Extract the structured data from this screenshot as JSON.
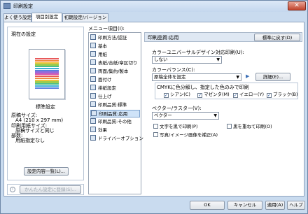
{
  "window": {
    "title": "印刷設定",
    "close_glyph": "✕"
  },
  "tabs": [
    {
      "label": "よく使う設定"
    },
    {
      "label": "項目別設定"
    },
    {
      "label": "初期設定/バージョン"
    }
  ],
  "left": {
    "current_settings_label": "現在の設定",
    "setting_name": "標準設定",
    "details": [
      "原稿サイズ:",
      "A4 (210 x 297 mm)",
      "印刷用紙サイズ:",
      "原稿サイズと同じ",
      "部数:",
      "用紙指定なし"
    ],
    "details_button": "設定内容一覧(L)...",
    "register_button": "かんたん設定に登録(S)..."
  },
  "menu": {
    "label": "メニュー項目(I):",
    "items": [
      {
        "label": "印刷方法/認証",
        "icon": "print-method-icon"
      },
      {
        "label": "基本",
        "icon": "basic-icon"
      },
      {
        "label": "用紙",
        "icon": "paper-icon"
      },
      {
        "label": "表紙/合紙/章区切り",
        "icon": "cover-icon"
      },
      {
        "label": "両面/集約/製本",
        "icon": "duplex-icon"
      },
      {
        "label": "面付け",
        "icon": "imposition-icon"
      },
      {
        "label": "排紙設定",
        "icon": "output-icon"
      },
      {
        "label": "仕上げ",
        "icon": "finish-icon"
      },
      {
        "label": "印刷品質:標準",
        "icon": "quality-standard-icon"
      },
      {
        "label": "印刷品質:応用",
        "icon": "quality-advanced-icon"
      },
      {
        "label": "印刷品質:その他",
        "icon": "quality-other-icon"
      },
      {
        "label": "効果",
        "icon": "effect-icon"
      },
      {
        "label": "ドライバーオプション",
        "icon": "driver-option-icon"
      }
    ]
  },
  "right": {
    "header": "印刷品質:応用",
    "reset_button": "標準に戻す(D)",
    "universal_design_label": "カラーユニバーサルデザイン対応印刷(U):",
    "universal_design_value": "しない",
    "color_balance_label": "カラーバランス(C):",
    "color_balance_value": "原稿全体を設定",
    "details_button": "詳細(E)...",
    "cmyk_label": "CMYKに色分解し、指定した色のみで印刷",
    "cmyk_options": [
      {
        "label": "シアン(C)",
        "checked": true
      },
      {
        "label": "マゼンタ(M)",
        "checked": true
      },
      {
        "label": "イエロー(Y)",
        "checked": true
      },
      {
        "label": "ブラック(B)",
        "checked": true
      }
    ],
    "vector_label": "ベクター/ラスター(V):",
    "vector_value": "ベクター",
    "black_text_label": "文字を黒で印刷(P)",
    "black_overprint_label": "黒を重ねて印刷(O)",
    "photo_correction_label": "写真/イメージ画像を補正(A)"
  },
  "bottom": {
    "ok": "OK",
    "cancel": "キャンセル",
    "apply": "適用(A)",
    "help": "ヘルプ"
  },
  "colors": {
    "selected_bg": "#cfe3f8",
    "window_bg": "#c9dbef",
    "close_red": "#c0442d"
  }
}
